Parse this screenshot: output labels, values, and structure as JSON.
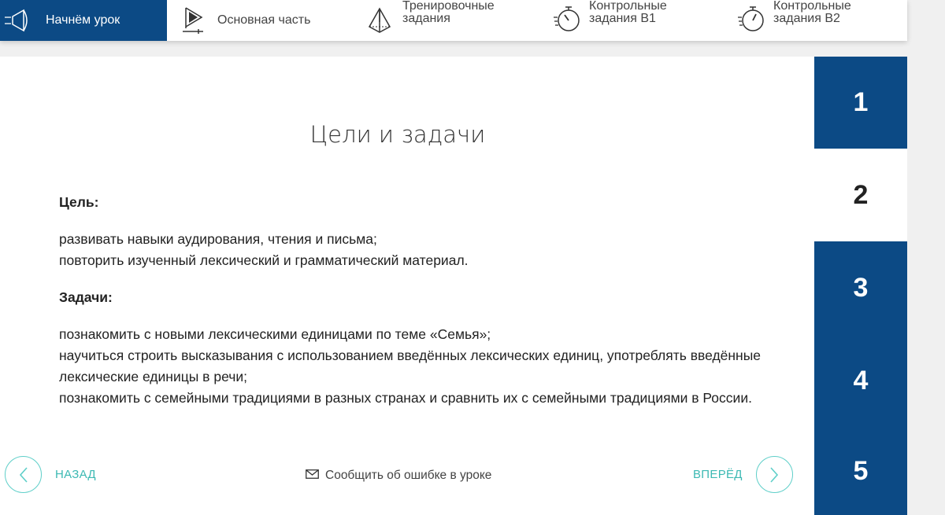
{
  "tabs": [
    {
      "label": "Начнём урок",
      "icon": "megaphone-icon",
      "active": true
    },
    {
      "label": "Основная часть",
      "icon": "play-icon",
      "active": false
    },
    {
      "label": "Тренировочные\nзадания",
      "icon": "pyramid-icon",
      "active": false
    },
    {
      "label": "Контрольные\nзадания B1",
      "icon": "stopwatch-icon",
      "active": false
    },
    {
      "label": "Контрольные\nзадания B2",
      "icon": "stopwatch-icon",
      "active": false
    }
  ],
  "content": {
    "title": "Цели и задачи",
    "goal_heading": "Цель:",
    "goal_lines": [
      "развивать навыки аудирования, чтения и письма;",
      "повторить изученный лексический и грамматический материал."
    ],
    "tasks_heading": "Задачи:",
    "tasks_lines": [
      "познакомить с новыми лексическими единицами по теме «Семья»;",
      "научиться строить высказывания с использованием введённых лексических единиц, употреблять введённые лексические единицы в речи;",
      "познакомить с семейными традициями в разных странах и сравнить их с семейными традициями в России."
    ]
  },
  "footer": {
    "back_label": "НАЗАД",
    "forward_label": "ВПЕРЁД",
    "report_label": "Сообщить об ошибке в уроке"
  },
  "steps": [
    "1",
    "2",
    "3",
    "4",
    "5"
  ],
  "current_step": "2",
  "colors": {
    "primary": "#0c4a85",
    "accent": "#3cb9b3"
  }
}
